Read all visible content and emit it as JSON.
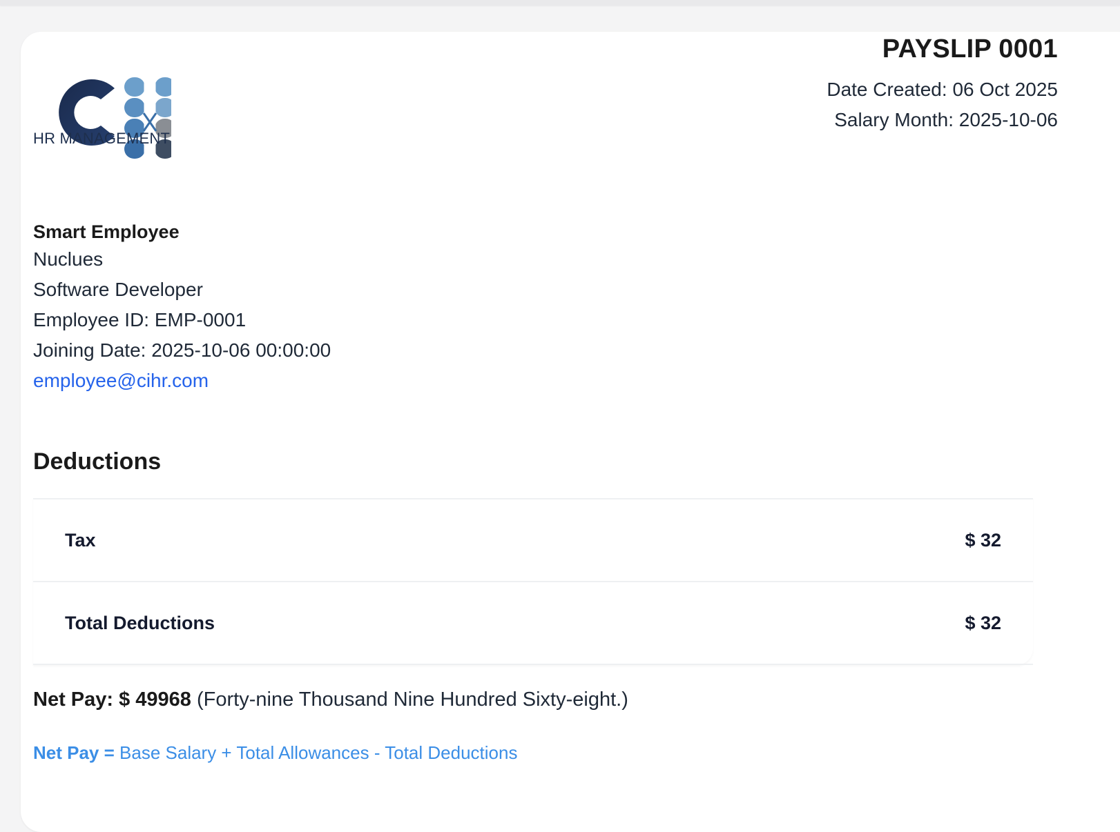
{
  "logo": {
    "text": "HR MANAGEMENT"
  },
  "payslip": {
    "title": "PAYSLIP 0001",
    "date_created": "Date Created: 06 Oct 2025",
    "salary_month": "Salary Month: 2025-10-06"
  },
  "employee": {
    "name": "Smart Employee",
    "company": "Nuclues",
    "position": "Software Developer",
    "employee_id": "Employee ID: EMP-0001",
    "joining_date": "Joining Date: 2025-10-06 00:00:00",
    "email": "employee@cihr.com"
  },
  "deductions": {
    "title": "Deductions",
    "rows": [
      {
        "label": "Tax",
        "value": "$ 32"
      },
      {
        "label": "Total Deductions",
        "value": "$ 32"
      }
    ]
  },
  "net_pay": {
    "label": "Net Pay: $ 49968",
    "words": "(Forty-nine Thousand Nine Hundred Sixty-eight.)"
  },
  "formula": {
    "label": "Net Pay =",
    "expression": "Base Salary + Total Allowances - Total Deductions"
  },
  "colors": {
    "link": "#2563eb",
    "formula": "#3b8ee6",
    "logo_navy": "#1e2f4d",
    "logo_blue": "#3a78b0"
  }
}
